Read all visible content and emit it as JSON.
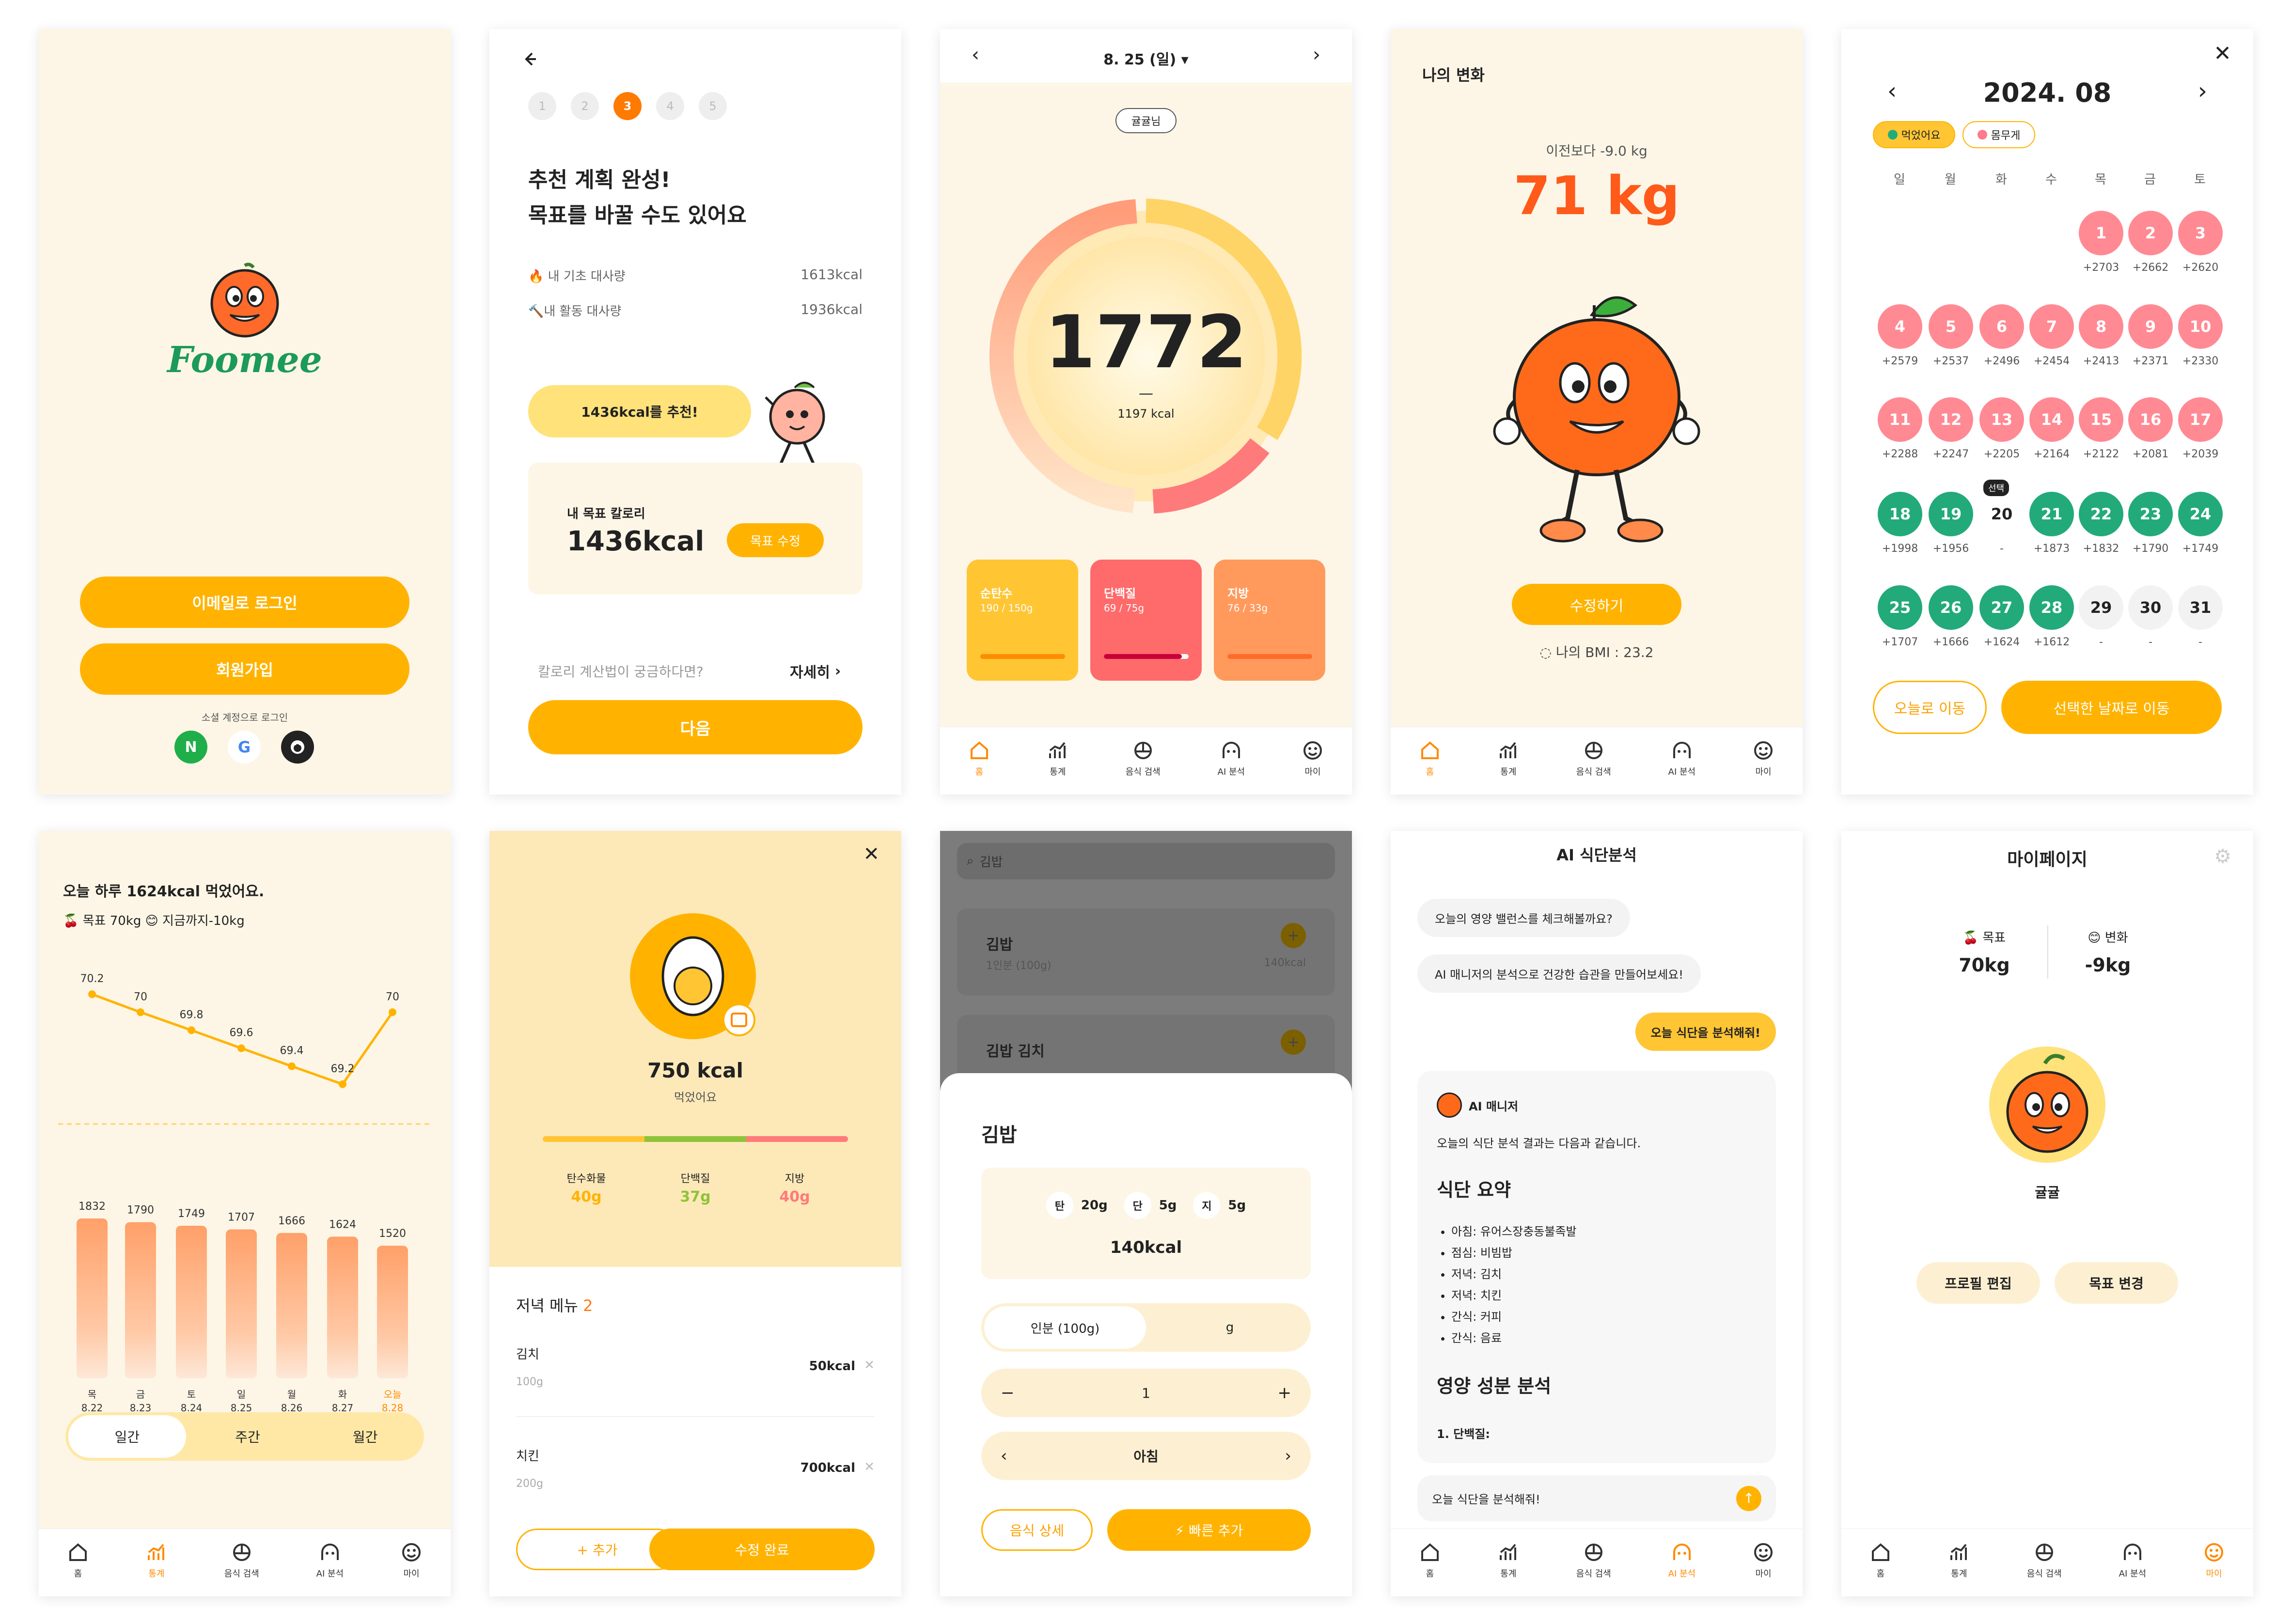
{
  "s1": {
    "brand": "Foomee",
    "email_login": "이메일로 로그인",
    "signup": "회원가입",
    "social_label": "소셜 계정으로 로그인",
    "naver": "N",
    "google": "G"
  },
  "s2": {
    "steps": [
      "1",
      "2",
      "3",
      "4",
      "5"
    ],
    "title1": "추천 계획 완성!",
    "title2": "목표를 바꿀 수도 있어요",
    "bmr_label": "🔥 내 기초 대사량",
    "bmr": "1613kcal",
    "amr_label": "🔨내 활동 대사량",
    "amr": "1936kcal",
    "recommend": "1436kcal를 추천!",
    "goal_label": "내 목표 칼로리",
    "goal": "1436kcal",
    "edit_goal": "목표 수정",
    "question": "칼로리 계산법이 궁금하다면?",
    "detail": "자세히",
    "next": "다음"
  },
  "s3": {
    "date": "8. 25 (일)",
    "nickname": "귤귤님",
    "kcal": "1772",
    "dash": "—",
    "target": "1197 kcal",
    "macros": [
      {
        "name": "순탄수",
        "val": "190 / 150g",
        "color": "#ffc533"
      },
      {
        "name": "단백질",
        "val": "69 / 75g",
        "color": "#ff6a6a"
      },
      {
        "name": "지방",
        "val": "76 / 33g",
        "color": "#ff9a5c"
      }
    ]
  },
  "s4": {
    "title": "나의 변화",
    "delta": "이전보다 -9.0 kg",
    "weight": "71 kg",
    "edit": "수정하기",
    "bmi": "나의 BMI : 23.2"
  },
  "s5": {
    "month": "2024. 08",
    "legend_ate": "먹었어요",
    "legend_weight": "몸무게",
    "weekdays": [
      "일",
      "월",
      "화",
      "수",
      "목",
      "금",
      "토"
    ],
    "weeks": [
      [
        [
          "",
          ""
        ],
        [
          "",
          ""
        ],
        [
          "",
          ""
        ],
        [
          "",
          ""
        ],
        [
          "1",
          "+2703"
        ],
        [
          "2",
          "+2662"
        ],
        [
          "3",
          "+2620"
        ]
      ],
      [
        [
          "4",
          "+2579"
        ],
        [
          "5",
          "+2537"
        ],
        [
          "6",
          "+2496"
        ],
        [
          "7",
          "+2454"
        ],
        [
          "8",
          "+2413"
        ],
        [
          "9",
          "+2371"
        ],
        [
          "10",
          "+2330"
        ]
      ],
      [
        [
          "11",
          "+2288"
        ],
        [
          "12",
          "+2247"
        ],
        [
          "13",
          "+2205"
        ],
        [
          "14",
          "+2164"
        ],
        [
          "15",
          "+2122"
        ],
        [
          "16",
          "+2081"
        ],
        [
          "17",
          "+2039"
        ]
      ],
      [
        [
          "18",
          "+1998"
        ],
        [
          "19",
          "+1956"
        ],
        [
          "20",
          "-"
        ],
        [
          "21",
          "+1873"
        ],
        [
          "22",
          "+1832"
        ],
        [
          "23",
          "+1790"
        ],
        [
          "24",
          "+1749"
        ]
      ],
      [
        [
          "25",
          "+1707"
        ],
        [
          "26",
          "+1666"
        ],
        [
          "27",
          "+1624"
        ],
        [
          "28",
          "+1612"
        ],
        [
          "29",
          "-"
        ],
        [
          "30",
          "-"
        ],
        [
          "31",
          "-"
        ]
      ]
    ],
    "selected_badge": "선택",
    "today_btn": "오늘로 이동",
    "go_btn": "선택한 날짜로 이동"
  },
  "s6": {
    "title": "오늘 하루 1624kcal 먹었어요.",
    "subtitle": "🍒 목표 70kg 😊 지금까지-10kg",
    "weights": [
      70.2,
      70,
      69.8,
      69.6,
      69.4,
      69.2,
      70
    ],
    "weight_labels": [
      "70.2",
      "70",
      "69.8",
      "69.6",
      "69.4",
      "69.2",
      "70"
    ],
    "kcals": [
      1832,
      1790,
      1749,
      1707,
      1666,
      1624,
      1520
    ],
    "kcal_labels": [
      "1832",
      "1790",
      "1749",
      "1707",
      "1666",
      "1624",
      "1520"
    ],
    "days": [
      "목",
      "금",
      "토",
      "일",
      "월",
      "화",
      "오늘"
    ],
    "dates": [
      "8.22",
      "8.23",
      "8.24",
      "8.25",
      "8.26",
      "8.27",
      "8.28"
    ],
    "tabs": [
      "일간",
      "주간",
      "월간"
    ]
  },
  "s7": {
    "kcal": "750 kcal",
    "ate": "먹었어요",
    "macros": [
      {
        "name": "탄수화물",
        "val": "40g",
        "color": "#ffc533"
      },
      {
        "name": "단백질",
        "val": "37g",
        "color": "#8fc33a"
      },
      {
        "name": "지방",
        "val": "40g",
        "color": "#ff7a7a"
      }
    ],
    "menu_title": "저녁 메뉴",
    "menu_count": "2",
    "items": [
      {
        "name": "김치",
        "amount": "100g",
        "kcal": "50kcal"
      },
      {
        "name": "치킨",
        "amount": "200g",
        "kcal": "700kcal"
      }
    ],
    "add": "+ 추가",
    "done": "수정 완료"
  },
  "s8": {
    "search": "김밥",
    "bg_items": [
      {
        "name": "김밥",
        "sub": "1인분 (100g)",
        "kcal": "140kcal"
      },
      {
        "name": "김밥 김치",
        "sub": "",
        "kcal": ""
      }
    ],
    "food": "김밥",
    "carb_tag": "탄",
    "carb": "20g",
    "prot_tag": "단",
    "prot": "5g",
    "fat_tag": "지",
    "fat": "5g",
    "kcal": "140kcal",
    "unit1": "인분 (100g)",
    "unit2": "g",
    "minus": "−",
    "qty": "1",
    "plus": "+",
    "meal": "아침",
    "detail": "음식 상세",
    "quick": "⚡ 빠른 추가"
  },
  "s9": {
    "title": "AI 식단분석",
    "bubble1": "오늘의 영양 밸런스를 체크해볼까요?",
    "bubble2": "AI 매니저의 분석으로 건강한 습관을 만들어보세요!",
    "user_msg": "오늘 식단을 분석해줘!",
    "manager": "AI 매니저",
    "intro": "오늘의 식단 분석 결과는 다음과 같습니다.",
    "summary_title": "식단 요약",
    "list": [
      "아침: 유어스장충동불족발",
      "점심: 비빔밥",
      "저녁: 김치",
      "저녁: 치킨",
      "간식: 커피",
      "간식: 음료"
    ],
    "nutri_title": "영양 성분 분석",
    "nutri_1": "1. 단백질:",
    "input": "오늘 식단을 분석해줘!"
  },
  "s10": {
    "title": "마이페이지",
    "goal_label": "🍒 목표",
    "goal": "70kg",
    "change_label": "😊 변화",
    "change": "-9kg",
    "nickname": "귤귤",
    "edit_profile": "프로필 편집",
    "edit_goal": "목표 변경"
  },
  "nav": [
    "홈",
    "통계",
    "음식 검색",
    "AI 분석",
    "마이"
  ]
}
